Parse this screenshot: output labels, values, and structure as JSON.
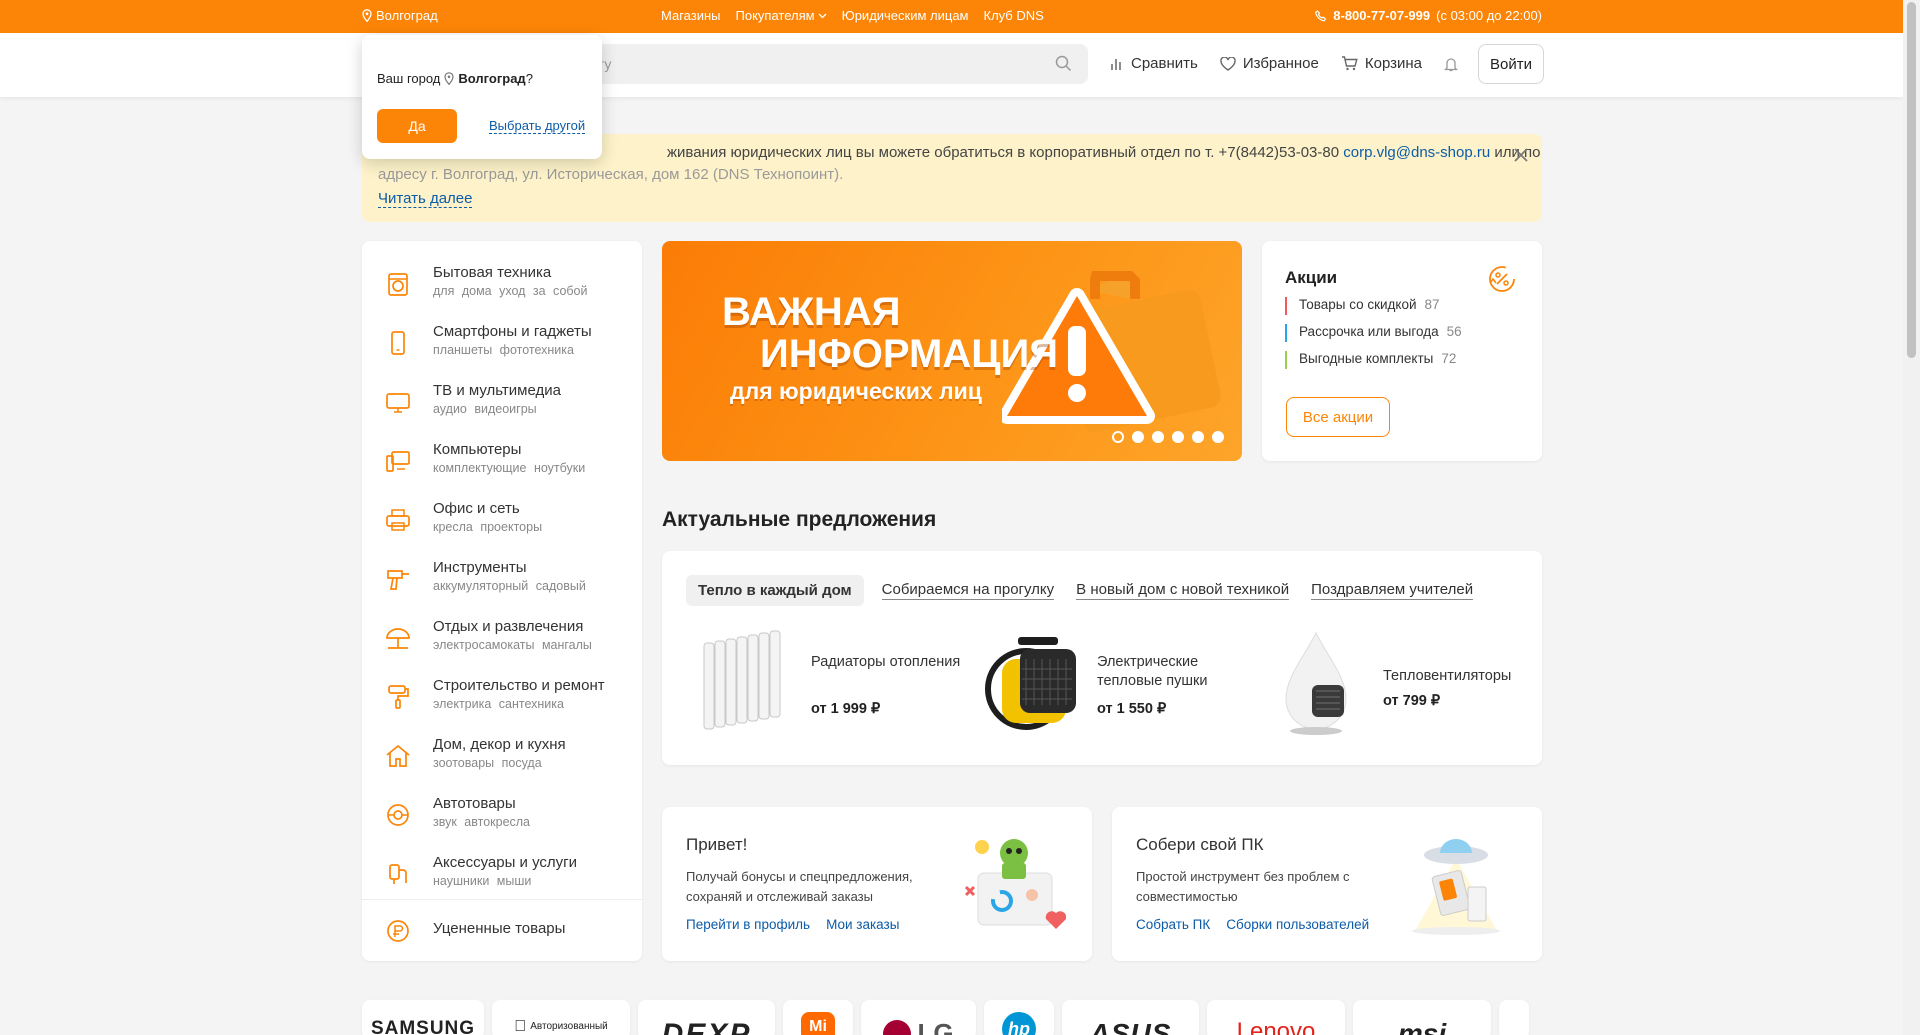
{
  "topbar": {
    "city": "Волгоград",
    "links": [
      "Магазины",
      "Покупателям",
      "Юридическим лицам",
      "Клуб DNS"
    ],
    "phone": "8-800-77-07-999",
    "hours": "(с 03:00 до 22:00)"
  },
  "header": {
    "search_placeholder": "йту",
    "compare": "Сравнить",
    "favorites": "Избранное",
    "cart": "Корзина",
    "login": "Войти"
  },
  "city_popup": {
    "question": "Ваш город",
    "city": "Волгоград",
    "question_mark": "?",
    "yes": "Да",
    "other": "Выбрать другой"
  },
  "notice": {
    "line1_text": "живания юридических лиц вы можете обратиться в корпоративный отдел по т. +7(8442)53-03-80 ",
    "email": "corp.vlg@dns-shop.ru",
    "line1_tail": "  или по",
    "line2": "адресу г. Волгоград, ул. Историческая, дом 162 (DNS Технопоинт).",
    "read_more": "Читать далее"
  },
  "catalog": {
    "items": [
      {
        "title": "Бытовая техника",
        "sub": "для дома уход за собой",
        "icon": "washing-machine-icon"
      },
      {
        "title": "Смартфоны и гаджеты",
        "sub": "планшеты фототехника",
        "icon": "smartphone-icon"
      },
      {
        "title": "ТВ и мультимедиа",
        "sub": "аудио видеоигры",
        "icon": "tv-icon"
      },
      {
        "title": "Компьютеры",
        "sub": "комплектующие ноутбуки",
        "icon": "computer-icon"
      },
      {
        "title": "Офис и сеть",
        "sub": "кресла проекторы",
        "icon": "printer-icon"
      },
      {
        "title": "Инструменты",
        "sub": "аккумуляторный садовый",
        "icon": "drill-icon"
      },
      {
        "title": "Отдых и развлечения",
        "sub": "электросамокаты мангалы",
        "icon": "umbrella-icon"
      },
      {
        "title": "Строительство и ремонт",
        "sub": "электрика сантехника",
        "icon": "paint-roller-icon"
      },
      {
        "title": "Дом, декор и кухня",
        "sub": "зоотовары посуда",
        "icon": "home-icon"
      },
      {
        "title": "Автотовары",
        "sub": "звук автокресла",
        "icon": "wheel-icon"
      },
      {
        "title": "Аксессуары и услуги",
        "sub": "наушники мыши",
        "icon": "accessories-icon"
      }
    ],
    "discounted": "Уцененные товары"
  },
  "banner": {
    "title_line1": "ВАЖНАЯ",
    "title_line2": "ИНФОРМАЦИЯ",
    "subtitle": "для юридических лиц",
    "slides": 6,
    "active_slide": 1
  },
  "promo": {
    "title": "Акции",
    "rows": [
      {
        "label": "Товары со скидкой",
        "count": "87",
        "color": "#f05a5a"
      },
      {
        "label": "Рассрочка или выгода",
        "count": "56",
        "color": "#2aa6e8"
      },
      {
        "label": "Выгодные комплекты",
        "count": "72",
        "color": "#9ad04b"
      }
    ],
    "all": "Все акции"
  },
  "offers": {
    "section_title": "Актуальные предложения",
    "tabs": [
      "Тепло в каждый дом",
      "Собираемся на прогулку",
      "В новый дом с новой техникой",
      "Поздравляем учителей"
    ],
    "active_tab": 0,
    "items": [
      {
        "name": "Радиаторы отопления",
        "price": "от 1 999 ₽"
      },
      {
        "name": "Электрические тепловые пушки",
        "price": "от 1 550 ₽"
      },
      {
        "name": "Тепловентиляторы",
        "price": "от 799 ₽"
      }
    ]
  },
  "hello": {
    "title": "Привет!",
    "desc": "Получай бонусы и спецпредложения, сохраняй и отслеживай заказы",
    "link1": "Перейти в профиль",
    "link2": "Мои заказы"
  },
  "build": {
    "title": "Собери свой ПК",
    "desc": "Простой инструмент без проблем с совместимостью",
    "link1": "Собрать ПК",
    "link2": "Сборки пользователей"
  },
  "brands": [
    {
      "name": "SAMSUNG",
      "color": "#1a1a1a"
    },
    {
      "name": "Авторизованный",
      "color": "#1a1a1a"
    },
    {
      "name": "DEXP",
      "color": "#1a1a1a"
    },
    {
      "name": "Mi",
      "color": "#ff6900"
    },
    {
      "name": "LG",
      "color": "#a50034"
    },
    {
      "name": "hp",
      "color": "#0096d6"
    },
    {
      "name": "ASUS",
      "color": "#1a1a1a"
    },
    {
      "name": "Lenovo",
      "color": "#e2231a"
    },
    {
      "name": "msi",
      "color": "#c00"
    }
  ],
  "colors": {
    "accent": "#fc8507",
    "link": "#0c5ca8",
    "notice_bg": "#fdf2c9"
  }
}
